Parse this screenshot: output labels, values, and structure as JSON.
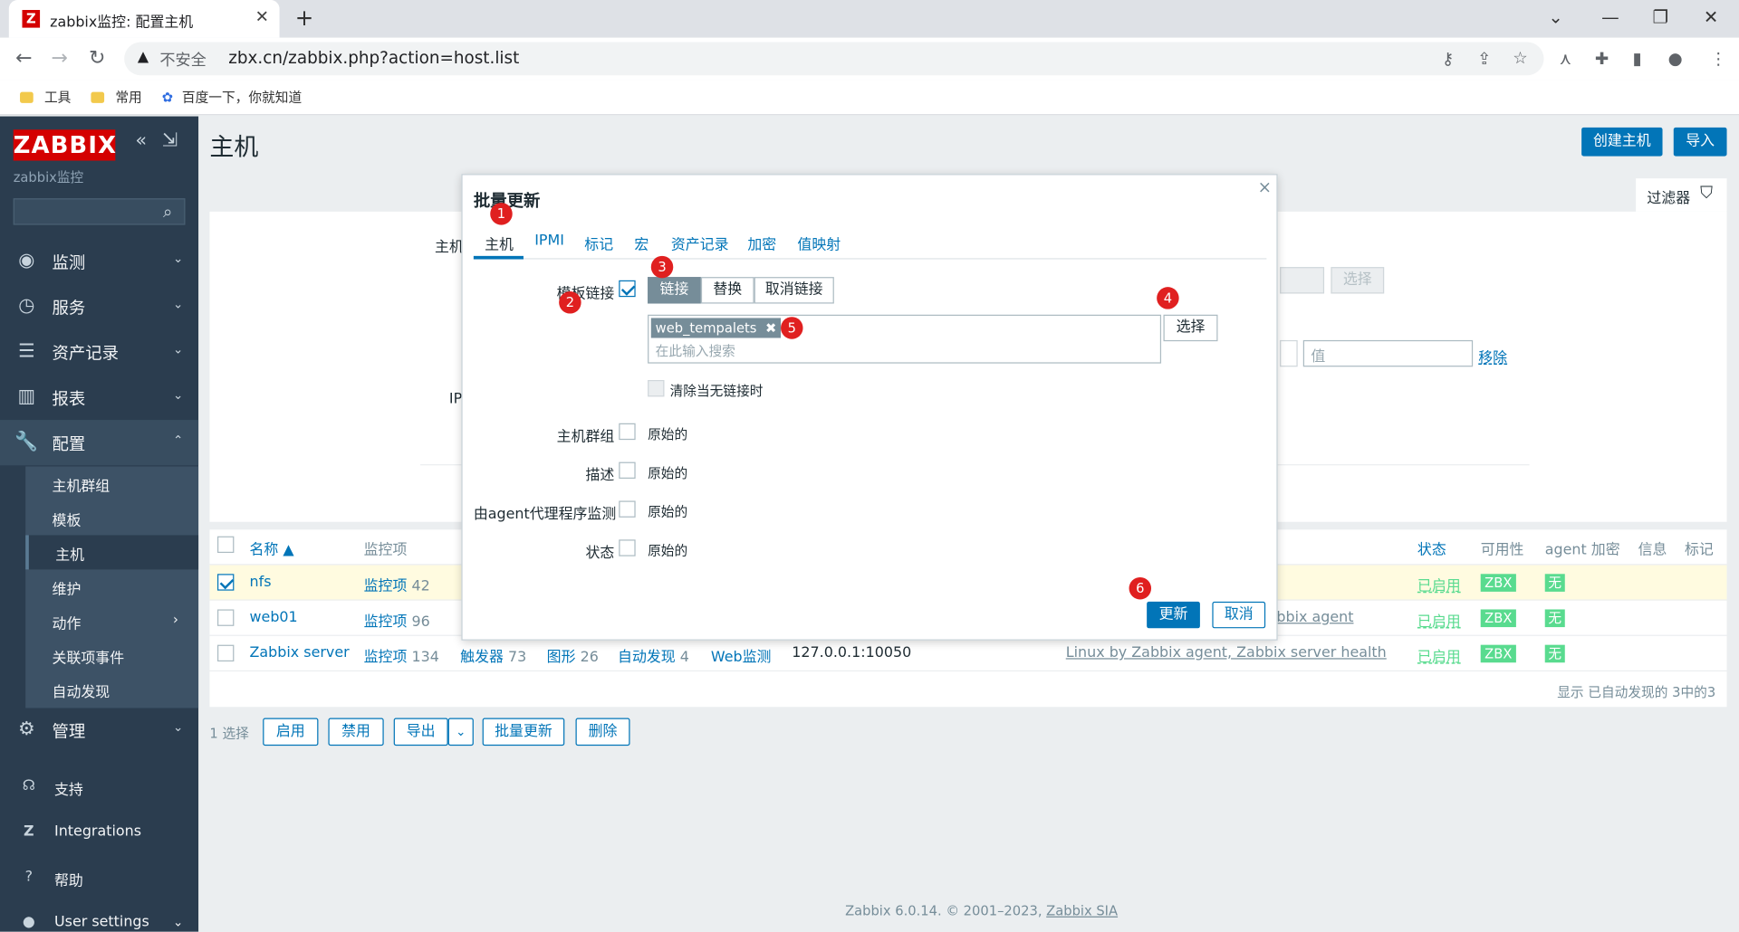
{
  "browser": {
    "tab_title": "zabbix监控: 配置主机",
    "favicon": "Z",
    "insecure": "不安全",
    "url": "zbx.cn/zabbix.php?action=host.list"
  },
  "bookmarks": [
    {
      "label": "工具"
    },
    {
      "label": "常用"
    },
    {
      "label": "百度一下，你就知道"
    }
  ],
  "sidebar": {
    "logo": "ZABBIX",
    "server_name": "zabbix监控",
    "menu": [
      {
        "label": "监测",
        "icon": "eye-icon"
      },
      {
        "label": "服务",
        "icon": "clock-icon"
      },
      {
        "label": "资产记录",
        "icon": "list-icon"
      },
      {
        "label": "报表",
        "icon": "bar-chart-icon"
      },
      {
        "label": "配置",
        "icon": "wrench-icon"
      }
    ],
    "submenu": [
      "主机群组",
      "模板",
      "主机",
      "维护",
      "动作",
      "关联项事件",
      "自动发现"
    ],
    "admin": "管理",
    "bottom": [
      "支持",
      "Integrations",
      "帮助",
      "User settings"
    ]
  },
  "page": {
    "title": "主机",
    "create_btn": "创建主机",
    "import_btn": "导入",
    "filter": "过滤器",
    "filter_bg": {
      "host_label": "主机",
      "ip_label": "IP",
      "select_btn": "选择",
      "value_placeholder": "值",
      "remove_link": "移除"
    }
  },
  "table": {
    "headers": {
      "name": "名称 ▲",
      "items": "监控项",
      "status": "状态",
      "availability": "可用性",
      "agent_enc": "agent 加密",
      "info": "信息",
      "tags": "标记"
    },
    "rows": [
      {
        "name": "nfs",
        "items": "监控项",
        "items_count": "42",
        "status": "已启用",
        "zbx": "ZBX",
        "enc": "无",
        "templates": ""
      },
      {
        "name": "web01",
        "items": "监控项",
        "items_count": "96",
        "status": "已启用",
        "zbx": "ZBX",
        "enc": "无",
        "templates": "bbix agent"
      },
      {
        "name": "Zabbix server",
        "items": "监控项",
        "items_count": "134",
        "triggers": "触发器",
        "triggers_count": "73",
        "graphs": "图形",
        "graphs_count": "26",
        "discovery": "自动发现",
        "discovery_count": "4",
        "web": "Web监测",
        "interface": "127.0.0.1:10050",
        "status": "已启用",
        "zbx": "ZBX",
        "enc": "无",
        "templates": "Linux by Zabbix agent, Zabbix server health"
      }
    ],
    "summary": "显示 已自动发现的 3中的3"
  },
  "actions": {
    "selected": "1 选择",
    "enable": "启用",
    "disable": "禁用",
    "export": "导出",
    "mass_update": "批量更新",
    "delete": "删除"
  },
  "modal": {
    "title": "批量更新",
    "tabs": [
      "主机",
      "IPMI",
      "标记",
      "宏",
      "资产记录",
      "加密",
      "值映射"
    ],
    "template_label": "模板链接",
    "seg": [
      "链接",
      "替换",
      "取消链接"
    ],
    "chip": "web_tempalets",
    "search_placeholder": "在此输入搜索",
    "select_btn": "选择",
    "clear_label": "清除当无链接时",
    "fields": [
      {
        "label": "主机群组",
        "value": "原始的"
      },
      {
        "label": "描述",
        "value": "原始的"
      },
      {
        "label": "由agent代理程序监测",
        "value": "原始的"
      },
      {
        "label": "状态",
        "value": "原始的"
      }
    ],
    "update": "更新",
    "cancel": "取消"
  },
  "annotations": [
    "1",
    "2",
    "3",
    "4",
    "5",
    "6"
  ],
  "footer": {
    "text": "Zabbix 6.0.14. © 2001–2023,",
    "link": "Zabbix SIA"
  }
}
